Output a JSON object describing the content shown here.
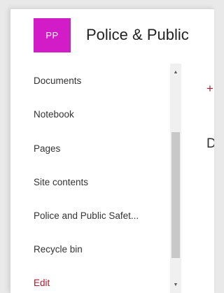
{
  "site": {
    "logo_text": "PP",
    "title": "Police & Public",
    "brand_color": "#d21cc8"
  },
  "nav": {
    "items": [
      {
        "label": "Documents"
      },
      {
        "label": "Notebook"
      },
      {
        "label": "Pages"
      },
      {
        "label": "Site contents"
      },
      {
        "label": "Police and Public Safet..."
      },
      {
        "label": "Recycle bin"
      }
    ],
    "edit_label": "Edit",
    "edit_color": "#b4172c"
  },
  "content": {
    "new_icon": "+",
    "partial_text": "D"
  }
}
